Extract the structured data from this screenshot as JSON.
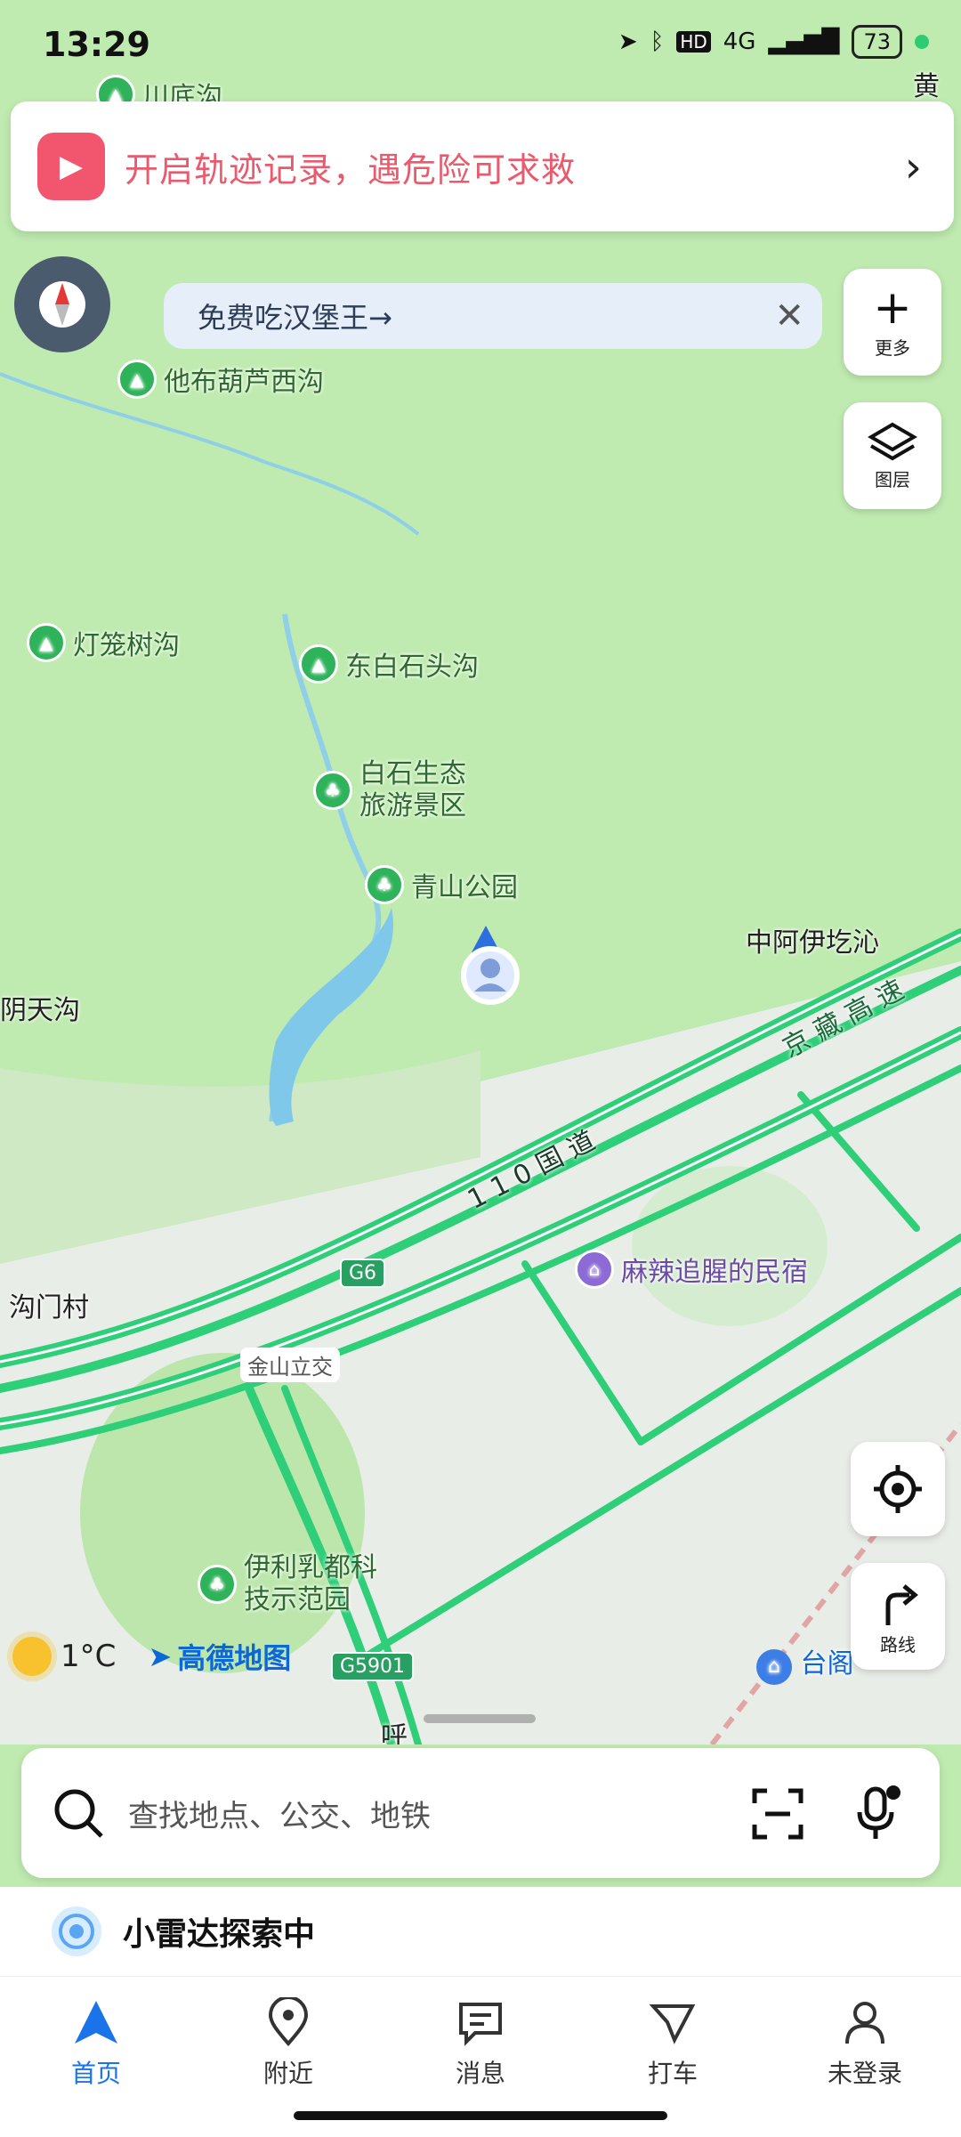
{
  "status_bar": {
    "time": "13:29",
    "battery": "73",
    "network": "4G",
    "hd": "HD",
    "corner_place": "黄土"
  },
  "banner": {
    "text": "开启轨迹记录，遇危险可求救",
    "icon": "video-camera-icon"
  },
  "promo": {
    "label": "免费吃汉堡王→"
  },
  "side_buttons": {
    "more_label": "更多",
    "layers_label": "图层",
    "route_label": "路线"
  },
  "map": {
    "pois": [
      {
        "name": "川底沟",
        "type": "mountain"
      },
      {
        "name": "他布葫芦西沟",
        "type": "mountain"
      },
      {
        "name": "灯笼树沟",
        "type": "mountain"
      },
      {
        "name": "东白石头沟",
        "type": "mountain"
      },
      {
        "name": "白石生态",
        "type": "park"
      },
      {
        "name": "旅游景区",
        "type": "park"
      },
      {
        "name": "青山公园",
        "type": "park"
      },
      {
        "name": "伊利乳都科",
        "type": "park"
      },
      {
        "name": "技示范园",
        "type": "park"
      },
      {
        "name": "麻辣追腥的民宿",
        "type": "hotel"
      }
    ],
    "labels": {
      "zhongayi": "中阿伊圪沁",
      "tiangou": "阴天沟",
      "gouman": "沟门村",
      "jingzang": "京 藏 高 速",
      "guodao": "1 1 0 国 道",
      "jinshan": "金山立交",
      "hu": "呼",
      "taige": "台阁"
    },
    "shields": {
      "g6": "G6",
      "g5901": "G5901"
    }
  },
  "weather": {
    "temp": "1°C",
    "brand": "高德地图"
  },
  "search": {
    "placeholder": "查找地点、公交、地铁"
  },
  "radar": {
    "text": "小雷达探索中"
  },
  "tabs": [
    {
      "label": "首页",
      "icon": "navigation-arrow-icon",
      "active": true
    },
    {
      "label": "附近",
      "icon": "location-pin-icon",
      "active": false
    },
    {
      "label": "消息",
      "icon": "message-icon",
      "active": false
    },
    {
      "label": "打车",
      "icon": "taxi-icon",
      "active": false
    },
    {
      "label": "未登录",
      "icon": "user-icon",
      "active": false
    }
  ],
  "colors": {
    "accent": "#1a73e8",
    "road": "#2ecc71",
    "banner_text": "#e85a6c"
  }
}
